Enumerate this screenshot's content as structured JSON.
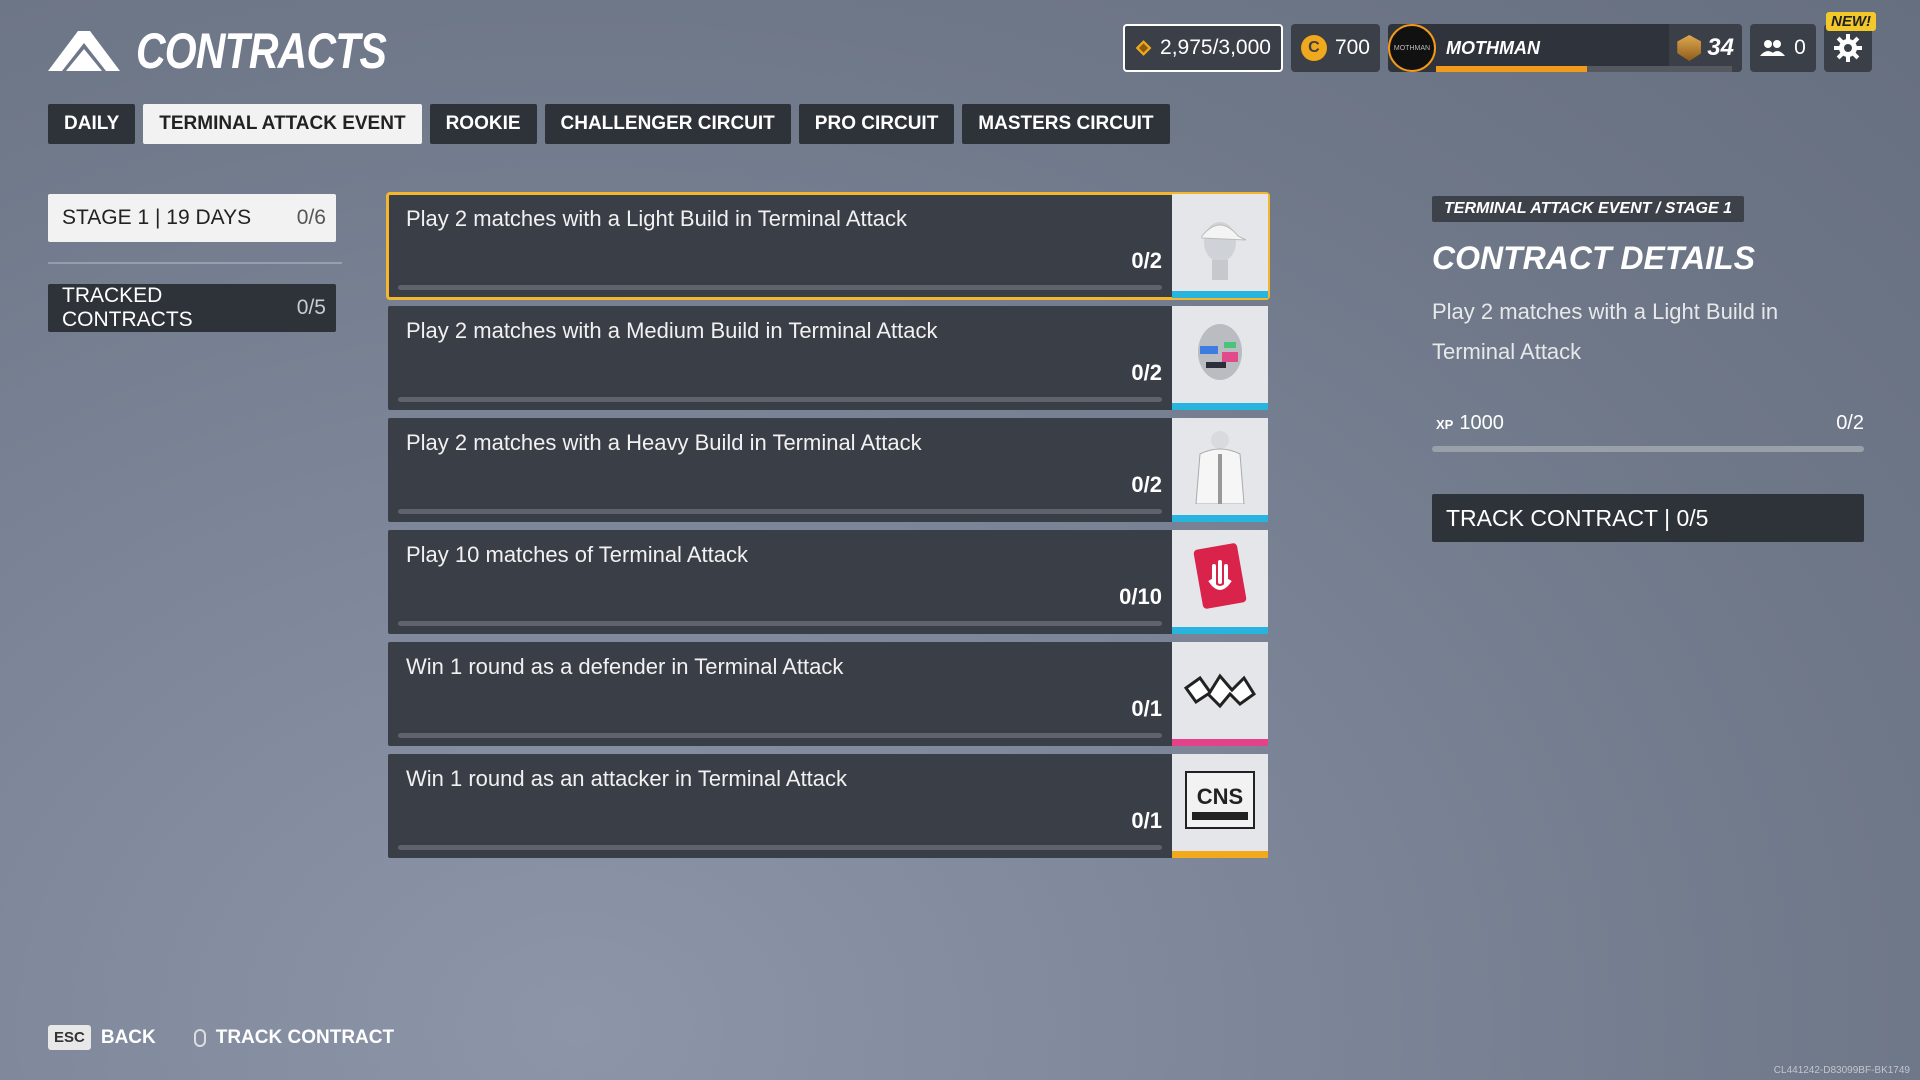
{
  "header": {
    "title": "CONTRACTS"
  },
  "topbar": {
    "xp": "2,975/3,000",
    "coins": "700",
    "coin_symbol": "C",
    "player_name": "MOTHMAN",
    "avatar_text": "MOTHMAN",
    "level": "34",
    "new_badge": "NEW!",
    "friends_count": "0",
    "level_progress": 0.51
  },
  "tabs": [
    "DAILY",
    "TERMINAL ATTACK EVENT",
    "ROOKIE",
    "CHALLENGER CIRCUIT",
    "PRO CIRCUIT",
    "MASTERS CIRCUIT"
  ],
  "active_tab": "TERMINAL ATTACK EVENT",
  "sidebar": {
    "stage_label": "STAGE 1  |  19 DAYS",
    "stage_count": "0/6",
    "tracked_label": "TRACKED CONTRACTS",
    "tracked_count": "0/5"
  },
  "contracts": [
    {
      "text": "Play 2 matches with a Light Build in Terminal Attack",
      "progress": "0/2",
      "icon": "cap-head-icon",
      "accent": "#27b5e0"
    },
    {
      "text": "Play 2 matches with a Medium Build in Terminal Attack",
      "progress": "0/2",
      "icon": "glitch-face-icon",
      "accent": "#27b5e0"
    },
    {
      "text": "Play 2 matches with a Heavy Build in Terminal Attack",
      "progress": "0/2",
      "icon": "white-suit-icon",
      "accent": "#27b5e0"
    },
    {
      "text": "Play 10 matches of Terminal Attack",
      "progress": "0/10",
      "icon": "hand-card-icon",
      "accent": "#27b5e0"
    },
    {
      "text": "Win 1 round as a defender in Terminal Attack",
      "progress": "0/1",
      "icon": "graffiti-tag-icon",
      "accent": "#e5418a"
    },
    {
      "text": "Win 1 round as an attacker in Terminal Attack",
      "progress": "0/1",
      "icon": "cns-banner-icon",
      "accent": "#f2a91c"
    }
  ],
  "details": {
    "crumb": "TERMINAL ATTACK EVENT / STAGE 1",
    "title": "CONTRACT DETAILS",
    "description": "Play 2 matches with a Light Build in Terminal Attack",
    "xp_label": "XP",
    "xp_value": "1000",
    "progress": "0/2",
    "track_button": "TRACK CONTRACT | 0/5"
  },
  "footer": {
    "esc_key": "ESC",
    "back_label": "BACK",
    "track_label": "TRACK CONTRACT"
  },
  "build_id": "CL441242-D83099BF-BK1749"
}
